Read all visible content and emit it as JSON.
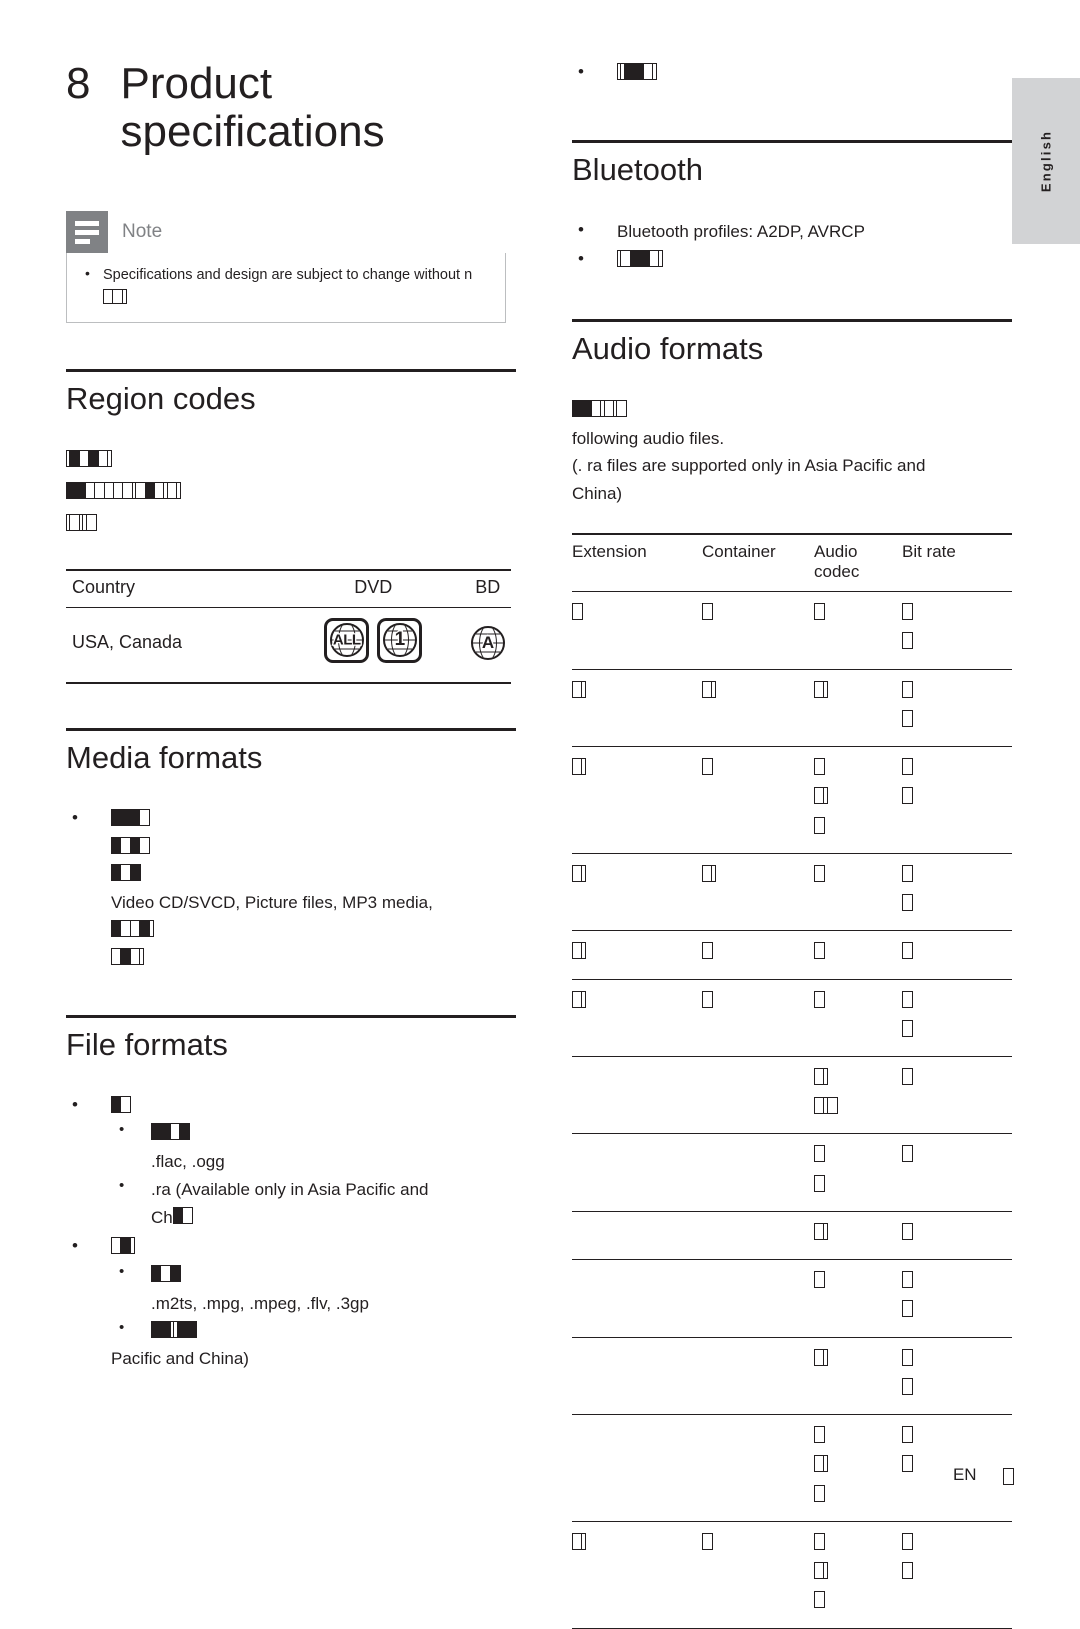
{
  "language_tab": {
    "label": "English"
  },
  "chapter": {
    "number": "8",
    "title": "Product specifications"
  },
  "note": {
    "icon": "note-icon",
    "label": "Note",
    "items": [
      {
        "text_before": "Specifications and design are subject to change without n",
        "tofu": [
          1,
          1,
          1
        ]
      }
    ]
  },
  "sections": {
    "region_codes": {
      "heading": "Region codes",
      "lines": [
        {
          "tofu": [
            1,
            1,
            1,
            1,
            1,
            1
          ]
        },
        {
          "tofu": [
            1,
            1,
            1,
            1,
            1,
            1,
            1,
            1,
            1,
            1,
            1,
            1,
            1,
            1
          ]
        },
        {
          "tofu": [
            1,
            1,
            1,
            1,
            1
          ]
        }
      ],
      "table": {
        "columns": [
          "Country",
          "DVD",
          "BD"
        ],
        "rows": [
          {
            "country": "USA, Canada",
            "dvd_icons": [
              {
                "name": "region-globe-all-icon",
                "text": "ALL",
                "shape": "rounded-square"
              },
              {
                "name": "region-globe-1-icon",
                "text": "1",
                "shape": "rounded-square"
              }
            ],
            "bd_icons": [
              {
                "name": "region-hex-a-icon",
                "text": "A",
                "shape": "hexagon"
              }
            ]
          }
        ]
      }
    },
    "media_formats": {
      "heading": "Media formats",
      "items": [
        {
          "type": "tofu",
          "tofu": [
            1,
            1,
            1,
            1
          ]
        },
        {
          "type": "tofu",
          "tofu": [
            1,
            1,
            1,
            1
          ]
        },
        {
          "type": "tofu",
          "tofu": [
            1,
            1,
            1
          ]
        },
        {
          "type": "text",
          "text": "Video CD/SVCD, Picture files, MP3 media,"
        },
        {
          "type": "tofu",
          "tofu": [
            1,
            1,
            1,
            1,
            1
          ]
        },
        {
          "type": "tofu",
          "tofu": [
            1,
            1,
            1,
            1
          ]
        }
      ]
    },
    "file_formats": {
      "heading": "File formats",
      "groups": [
        {
          "label_tofu": [
            1,
            1
          ],
          "children": [
            {
              "type": "tofu",
              "tofu": [
                1,
                1,
                1,
                1
              ]
            },
            {
              "type": "text",
              "text": ".flac, .ogg"
            },
            {
              "type": "text",
              "text": ".ra (Available only in Asia Pacific and",
              "bullet": true
            },
            {
              "type": "tofu_text",
              "text": "Ch",
              "tofu": [
                1,
                1
              ]
            }
          ]
        },
        {
          "label_tofu": [
            1,
            1
          ],
          "children": [
            {
              "type": "tofu",
              "tofu": [
                1,
                1,
                1
              ]
            },
            {
              "type": "text",
              "text": ".m2ts, .mpg, .mpeg, .flv, .3gp"
            },
            {
              "type": "tofu",
              "tofu": [
                1,
                1,
                1,
                1,
                1,
                1
              ],
              "bullet": true
            },
            {
              "type": "text",
              "text": "Pacific and China)"
            }
          ]
        }
      ]
    },
    "top_right_bullet": {
      "tofu": [
        1,
        1,
        1,
        1,
        1
      ]
    },
    "bluetooth": {
      "heading": "Bluetooth",
      "items": [
        {
          "type": "text",
          "text": "Bluetooth profiles: A2DP, AVRCP"
        },
        {
          "type": "tofu",
          "tofu": [
            1,
            1,
            1,
            1,
            1,
            1
          ]
        }
      ]
    },
    "audio_formats": {
      "heading": "Audio formats",
      "intro_tofu": [
        1,
        1,
        1,
        1,
        1,
        1,
        1
      ],
      "intro_lines": [
        "following audio files.",
        "(. ra files are supported only in Asia Pacific and",
        "China)"
      ],
      "table": {
        "columns": [
          "Extension",
          "Container",
          "Audio codec",
          "Bit rate"
        ],
        "rows": [
          {
            "extension": [
              1
            ],
            "container": [
              1
            ],
            "codec": [
              [
                1
              ]
            ],
            "bitrate": [
              [
                1
              ],
              [
                1
              ]
            ]
          },
          {
            "extension": [
              1,
              1
            ],
            "container": [
              1,
              1
            ],
            "codec": [
              [
                1,
                1
              ]
            ],
            "bitrate": [
              [
                1
              ],
              [
                1
              ]
            ]
          },
          {
            "extension": [
              1,
              1
            ],
            "container": [
              1
            ],
            "codec": [
              [
                1
              ],
              [
                1,
                1
              ],
              [
                1
              ]
            ],
            "bitrate": [
              [
                1
              ],
              [
                1
              ]
            ]
          },
          {
            "extension": [
              1,
              1
            ],
            "container": [
              1,
              1
            ],
            "codec": [
              [
                1
              ]
            ],
            "bitrate": [
              [
                1
              ],
              [
                1
              ]
            ]
          },
          {
            "extension": [
              1,
              1
            ],
            "container": [
              1
            ],
            "codec": [
              [
                1
              ]
            ],
            "bitrate": [
              [
                1
              ]
            ]
          },
          {
            "extension": [
              1,
              1
            ],
            "container": [
              1
            ],
            "codec": [
              [
                1
              ]
            ],
            "bitrate": [
              [
                1
              ],
              [
                1
              ]
            ]
          },
          {
            "extension": [],
            "container": [],
            "codec": [
              [
                1,
                1
              ],
              [
                1,
                1,
                1
              ]
            ],
            "bitrate": [
              [
                1
              ]
            ]
          },
          {
            "extension": [],
            "container": [],
            "codec": [
              [
                1
              ],
              [
                1
              ]
            ],
            "bitrate": [
              [
                1
              ]
            ]
          },
          {
            "extension": [],
            "container": [],
            "codec": [
              [
                1,
                1
              ]
            ],
            "bitrate": [
              [
                1
              ]
            ]
          },
          {
            "extension": [],
            "container": [],
            "codec": [
              [
                1
              ]
            ],
            "bitrate": [
              [
                1
              ],
              [
                1
              ]
            ]
          },
          {
            "extension": [],
            "container": [],
            "codec": [
              [
                1,
                1
              ]
            ],
            "bitrate": [
              [
                1
              ],
              [
                1
              ]
            ]
          },
          {
            "extension": [],
            "container": [],
            "codec": [
              [
                1
              ],
              [
                1,
                1
              ],
              [
                1
              ]
            ],
            "bitrate": [
              [
                1
              ],
              [
                1
              ]
            ]
          },
          {
            "extension": [
              1,
              1
            ],
            "container": [
              1
            ],
            "codec": [
              [
                1
              ],
              [
                1,
                1
              ],
              [
                1
              ]
            ],
            "bitrate": [
              [
                1
              ],
              [
                1
              ]
            ]
          }
        ]
      }
    }
  },
  "footer": {
    "en": "EN",
    "page_tofu": [
      1
    ]
  },
  "colors": {
    "text": "#231f20",
    "note_grey": "#808285",
    "note_border": "#bcbec0",
    "lang_tab_grey": "#d2d3d5"
  }
}
